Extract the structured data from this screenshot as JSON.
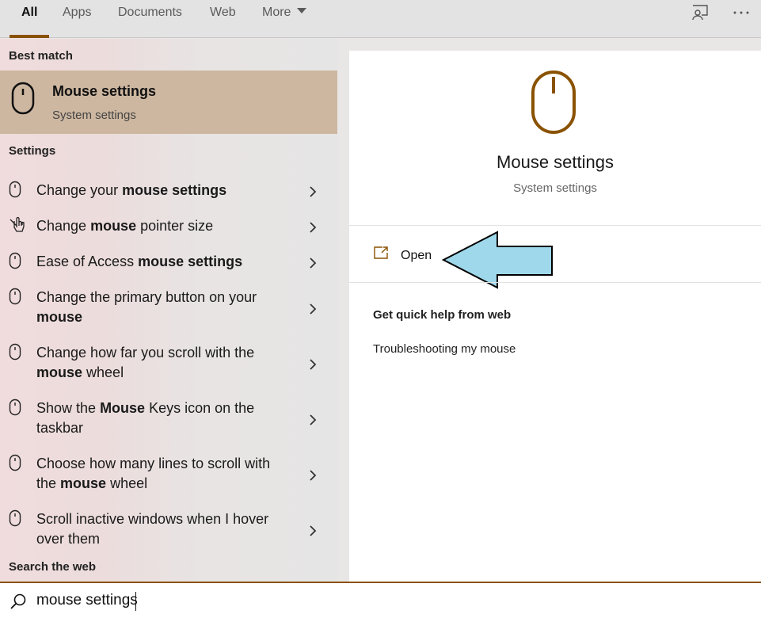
{
  "tabs": [
    {
      "label": "All",
      "active": true
    },
    {
      "label": "Apps"
    },
    {
      "label": "Documents"
    },
    {
      "label": "Web"
    },
    {
      "label": "More"
    }
  ],
  "toolbar": {
    "feedback_icon": "feedback-icon",
    "more_icon": "ellipsis-icon"
  },
  "left": {
    "best_match_title": "Best match",
    "best": {
      "title": "Mouse settings",
      "subtitle": "System settings",
      "icon": "mouse-icon"
    },
    "settings_title": "Settings",
    "items": [
      {
        "icon": "mouse-icon",
        "parts": [
          [
            "Change your ",
            false
          ],
          [
            "mouse settings",
            true
          ]
        ]
      },
      {
        "icon": "pointer-hand-icon",
        "parts": [
          [
            "Change ",
            false
          ],
          [
            "mouse",
            true
          ],
          [
            " pointer size",
            false
          ]
        ]
      },
      {
        "icon": "mouse-icon",
        "parts": [
          [
            "Ease of Access ",
            false
          ],
          [
            "mouse settings",
            true
          ]
        ]
      },
      {
        "icon": "mouse-icon",
        "parts": [
          [
            "Change the primary button on your ",
            false
          ],
          [
            "mouse",
            true
          ]
        ]
      },
      {
        "icon": "mouse-icon",
        "parts": [
          [
            "Change how far you scroll with the ",
            false
          ],
          [
            "mouse",
            true
          ],
          [
            " wheel",
            false
          ]
        ]
      },
      {
        "icon": "mouse-icon",
        "parts": [
          [
            "Show the ",
            false
          ],
          [
            "Mouse",
            true
          ],
          [
            " Keys icon on the taskbar",
            false
          ]
        ]
      },
      {
        "icon": "mouse-icon",
        "parts": [
          [
            "Choose how many lines to scroll with the ",
            false
          ],
          [
            "mouse",
            true
          ],
          [
            " wheel",
            false
          ]
        ]
      },
      {
        "icon": "mouse-icon",
        "parts": [
          [
            "Scroll inactive windows when I hover over them",
            false
          ]
        ]
      }
    ],
    "web_title": "Search the web"
  },
  "right": {
    "title": "Mouse settings",
    "subtitle": "System settings",
    "open_label": "Open",
    "help_title": "Get quick help from web",
    "help_link": "Troubleshooting my mouse"
  },
  "search": {
    "value": "mouse settings"
  },
  "colors": {
    "accent": "#8a5200",
    "best_bg": "#cdb7a0",
    "arrow_fill": "#9fd8ea"
  }
}
